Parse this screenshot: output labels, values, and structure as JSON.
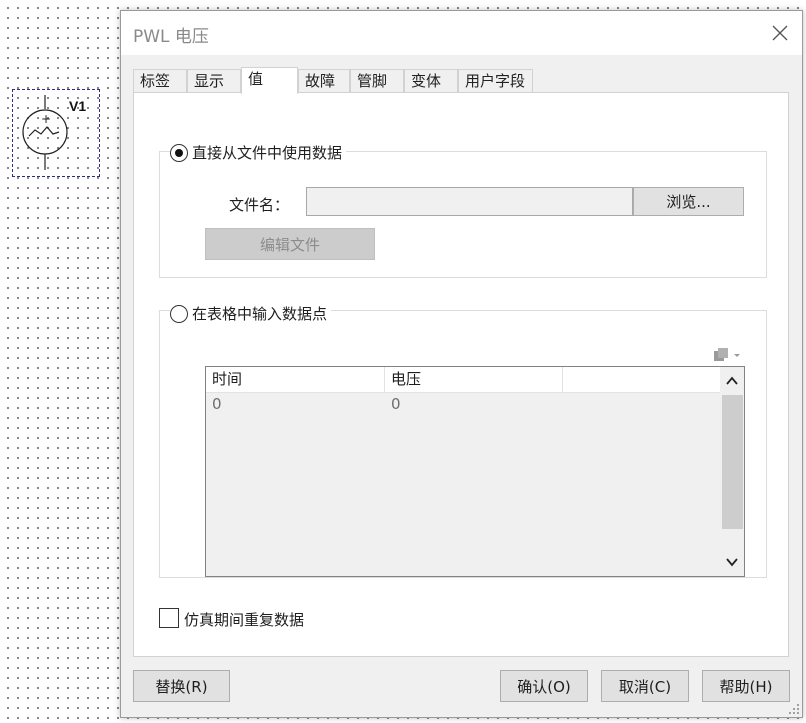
{
  "component": {
    "name": "V1"
  },
  "dialog": {
    "title": "PWL 电压",
    "tabs": [
      {
        "label": "标签"
      },
      {
        "label": "显示"
      },
      {
        "label": "值"
      },
      {
        "label": "故障"
      },
      {
        "label": "管脚"
      },
      {
        "label": "变体"
      },
      {
        "label": "用户字段"
      }
    ],
    "active_tab": "值",
    "file_group": {
      "radio_label": "直接从文件中使用数据",
      "selected": true,
      "filename_label": "文件名：",
      "filename_value": "",
      "browse_label": "浏览...",
      "edit_label": "编辑文件"
    },
    "table_group": {
      "radio_label": "在表格中输入数据点",
      "selected": false,
      "columns": [
        "时间",
        "电压"
      ],
      "rows": [
        [
          "0",
          "0"
        ]
      ]
    },
    "repeat_checkbox": {
      "label": "仿真期间重复数据",
      "checked": false
    },
    "buttons": {
      "replace": "替换(R)",
      "ok": "确认(O)",
      "cancel": "取消(C)",
      "help": "帮助(H)"
    }
  }
}
